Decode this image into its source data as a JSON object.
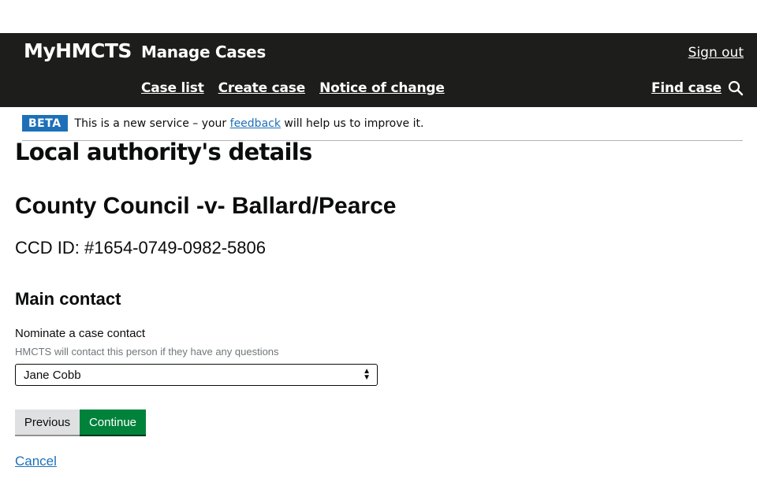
{
  "header": {
    "brand": "MyHMCTS",
    "service": "Manage Cases",
    "sign_out": "Sign out",
    "nav": [
      "Case list",
      "Create case",
      "Notice of change"
    ],
    "find_case": "Find case",
    "search_icon": "search-icon"
  },
  "beta_banner": {
    "tag": "BETA",
    "text_before": "This is a new service – your ",
    "link": "feedback",
    "text_after": " will help us to improve it.",
    "tag_color": "#1d70b8"
  },
  "page": {
    "title": "Local authority's details",
    "case_title": "County Council -v- Ballard/Pearce",
    "case_id": "CCD ID: #1654-0749-0982-5806"
  },
  "main_contact": {
    "heading": "Main contact",
    "label": "Nominate a case contact",
    "hint": "HMCTS will contact this person if they have any questions",
    "selected": "Jane Cobb"
  },
  "buttons": {
    "previous": "Previous",
    "continue": "Continue",
    "continue_color": "#00823b",
    "cancel": "Cancel"
  }
}
